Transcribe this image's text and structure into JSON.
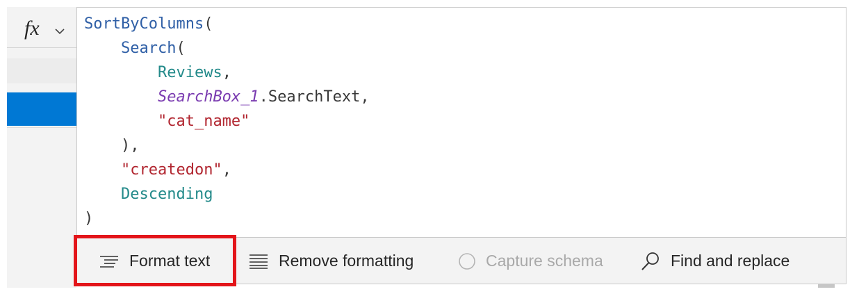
{
  "formula_bar": {
    "fx_label": "fx",
    "fx_dropdown_icon": "chevron-down-icon"
  },
  "code": {
    "line1_fn": "SortByColumns",
    "line1_paren": "(",
    "line2_fn": "Search",
    "line2_paren": "(",
    "line3_ident": "Reviews",
    "line3_comma": ",",
    "line4_control": "SearchBox_1",
    "line4_prop": ".SearchText,",
    "line5_string": "\"cat_name\"",
    "line6": "),",
    "line7_string": "\"createdon\"",
    "line7_comma": ",",
    "line8_ident": "Descending",
    "line9": ")"
  },
  "toolbar": {
    "format_text_label": "Format text",
    "remove_formatting_label": "Remove formatting",
    "capture_schema_label": "Capture schema",
    "find_replace_label": "Find and replace"
  },
  "colors": {
    "function": "#2f5fa6",
    "identifier": "#238a8a",
    "control": "#7a3bb0",
    "string": "#b1252f",
    "selection": "#0078d4",
    "highlight_box": "#e3151a"
  }
}
